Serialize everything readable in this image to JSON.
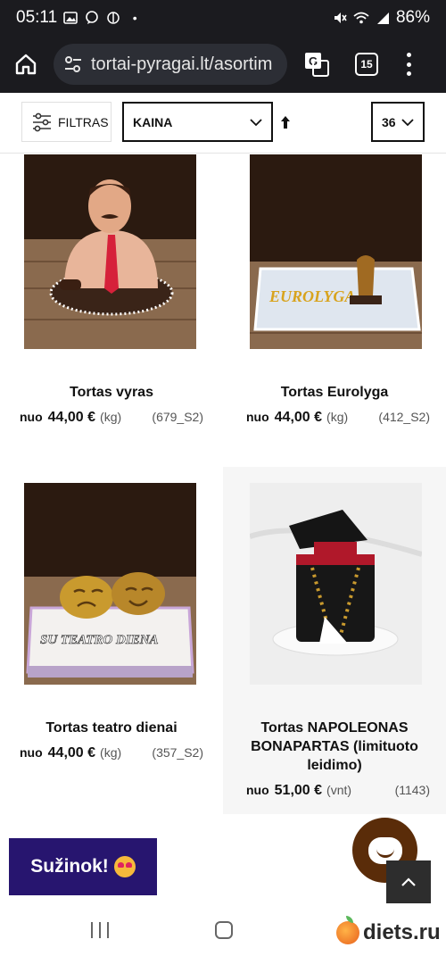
{
  "status_bar": {
    "time": "05:11",
    "battery": "86%"
  },
  "browser": {
    "url": "tortai-pyragai.lt/asortim",
    "tab_count": "15"
  },
  "filters": {
    "filter_label": "FILTRAS",
    "sort_value": "KAINA",
    "per_page_value": "36"
  },
  "products": [
    {
      "name": "Tortas vyras",
      "from": "nuo",
      "price": "44,00 €",
      "unit": "(kg)",
      "code": "(679_S2)"
    },
    {
      "name": "Tortas Eurolyga",
      "from": "nuo",
      "price": "44,00 €",
      "unit": "(kg)",
      "code": "(412_S2)",
      "image_text": "EUROLYGA"
    },
    {
      "name": "Tortas teatro dienai",
      "from": "nuo",
      "price": "44,00 €",
      "unit": "(kg)",
      "code": "(357_S2)",
      "image_text": "SU TEATRO DIENA"
    },
    {
      "name": "Tortas NAPOLEONAS BONAPARTAS (limituoto leidimo)",
      "from": "nuo",
      "price": "51,00 €",
      "unit": "(vnt)",
      "code": "(1143)"
    }
  ],
  "promo": {
    "label": "Sužinok!"
  },
  "watermark": {
    "text": "diets.ru"
  },
  "colors": {
    "promo_bg": "#27156f",
    "chat_bg": "#5a2c09",
    "browser_bg": "#1b1b1f"
  }
}
